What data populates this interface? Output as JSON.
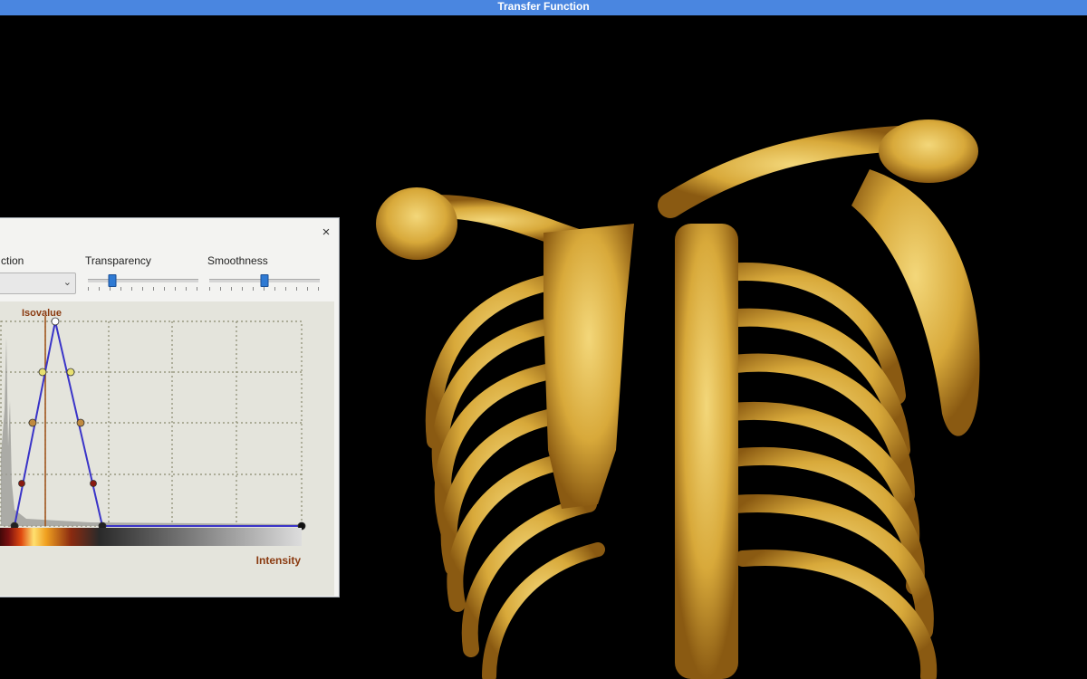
{
  "window": {
    "title": "Transfer Function"
  },
  "panel": {
    "function_label": "ction",
    "transparency_label": "Transparency",
    "smoothness_label": "Smoothness",
    "transparency_level": 0.22,
    "smoothness_level": 0.5,
    "isovalue_label": "Isovalue",
    "intensity_label": "Intensity",
    "close_glyph": "×"
  },
  "colors": {
    "titlebar": "#4a86e0",
    "bone": "#e0b84a",
    "curve": "#3a34c8",
    "isovalue_line": "#a0561e"
  },
  "icons": [
    "close-icon",
    "chevron-down-icon"
  ]
}
